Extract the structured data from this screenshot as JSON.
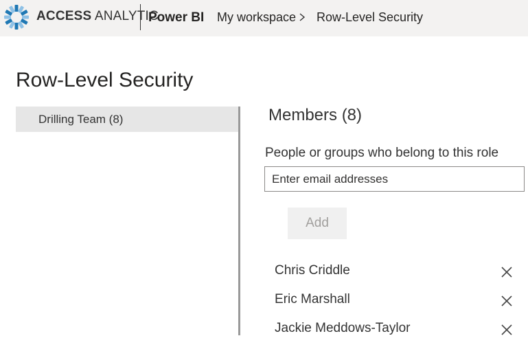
{
  "header": {
    "brand_bold": "ACCESS",
    "brand_light": "ANALYTIC",
    "product": "Power BI",
    "breadcrumb": {
      "workspace": "My workspace",
      "current": "Row-Level Security"
    }
  },
  "page": {
    "title": "Row-Level Security"
  },
  "roles": [
    {
      "label": "Drilling Team (8)"
    }
  ],
  "members": {
    "title": "Members (8)",
    "field_label": "People or groups who belong to this role",
    "input_placeholder": "Enter email addresses",
    "input_value": "",
    "add_label": "Add",
    "list": [
      {
        "name": "Chris Criddle"
      },
      {
        "name": "Eric Marshall"
      },
      {
        "name": "Jackie Meddows-Taylor"
      }
    ]
  },
  "icons": {
    "logo": "access-analytic-logo-icon",
    "breadcrumb_separator": "chevron-right-icon",
    "remove": "close-icon"
  },
  "colors": {
    "logo_blue": "#1f78b4",
    "logo_light": "#8ec1e6",
    "topbar_bg": "#f3f2f1",
    "role_selected_bg": "#e6e6e6"
  }
}
